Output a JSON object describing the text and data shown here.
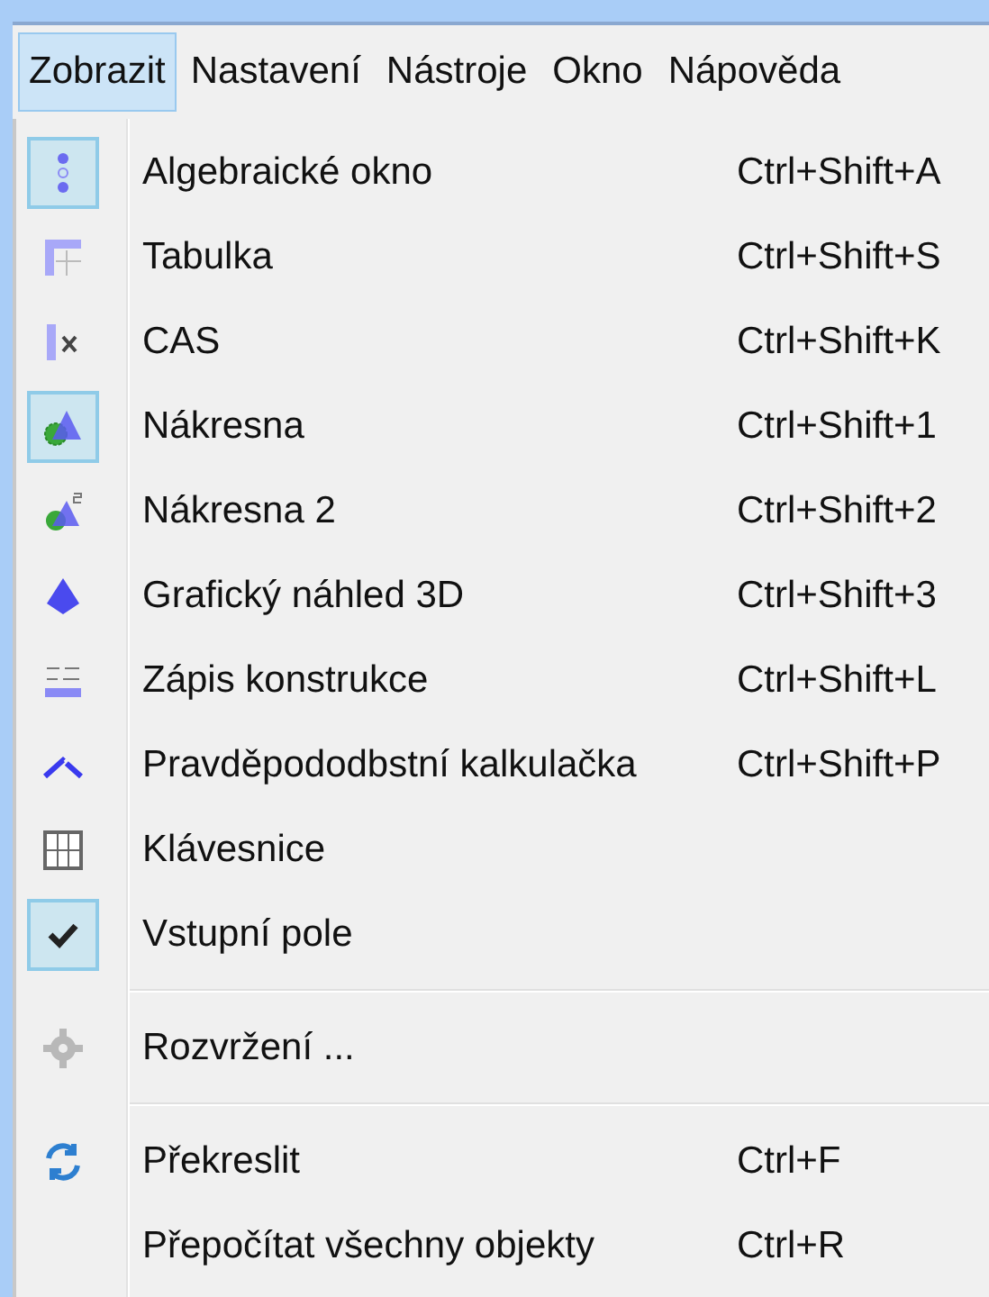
{
  "menubar": [
    {
      "label": "Zobrazit",
      "selected": true
    },
    {
      "label": "Nastavení",
      "selected": false
    },
    {
      "label": "Nástroje",
      "selected": false
    },
    {
      "label": "Okno",
      "selected": false
    },
    {
      "label": "Nápověda",
      "selected": false
    }
  ],
  "menu": [
    {
      "kind": "item",
      "label": "Algebraické okno",
      "shortcut": "Ctrl+Shift+A",
      "checked": true
    },
    {
      "kind": "item",
      "label": "Tabulka",
      "shortcut": "Ctrl+Shift+S",
      "checked": false
    },
    {
      "kind": "item",
      "label": "CAS",
      "shortcut": "Ctrl+Shift+K",
      "checked": false
    },
    {
      "kind": "item",
      "label": "Nákresna",
      "shortcut": "Ctrl+Shift+1",
      "checked": true
    },
    {
      "kind": "item",
      "label": "Nákresna 2",
      "shortcut": "Ctrl+Shift+2",
      "checked": false
    },
    {
      "kind": "item",
      "label": "Grafický náhled 3D",
      "shortcut": "Ctrl+Shift+3",
      "checked": false
    },
    {
      "kind": "item",
      "label": "Zápis konstrukce",
      "shortcut": "Ctrl+Shift+L",
      "checked": false
    },
    {
      "kind": "item",
      "label": "Pravděpododbstní kalkulačka",
      "shortcut": "Ctrl+Shift+P",
      "checked": false
    },
    {
      "kind": "item",
      "label": "Klávesnice",
      "checked": false
    },
    {
      "kind": "item",
      "label": "Vstupní pole",
      "checked": true
    },
    {
      "kind": "separator"
    },
    {
      "kind": "item",
      "label": "Rozvržení ...",
      "checked": false
    },
    {
      "kind": "separator"
    },
    {
      "kind": "item",
      "label": "Překreslit",
      "shortcut": "Ctrl+F",
      "checked": false
    },
    {
      "kind": "item",
      "label": "Přepočítat všechny objekty",
      "shortcut": "Ctrl+R",
      "checked": false
    }
  ]
}
